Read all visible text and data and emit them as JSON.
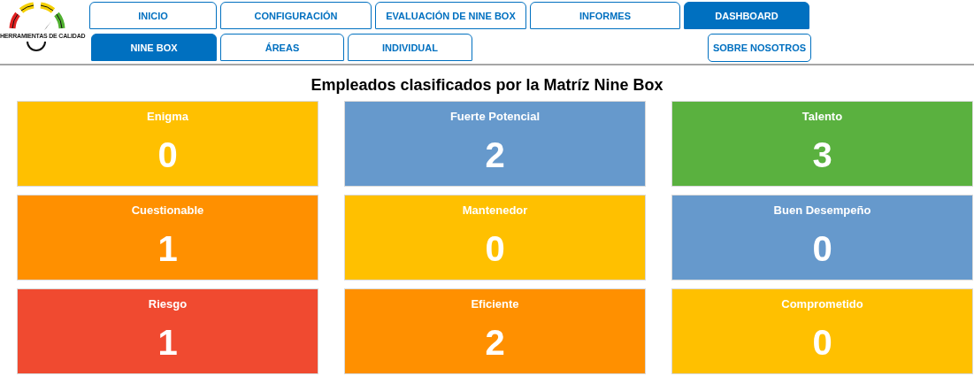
{
  "logo": {
    "caption": "HERRAMIENTAS DE CALIDAD"
  },
  "primary_tabs": [
    {
      "label": "INICIO",
      "selected": false
    },
    {
      "label": "CONFIGURACIÓN",
      "selected": false
    },
    {
      "label": "EVALUACIÓN DE NINE BOX",
      "selected": false
    },
    {
      "label": "INFORMES",
      "selected": false
    },
    {
      "label": "DASHBOARD",
      "selected": true
    }
  ],
  "secondary_tabs": [
    {
      "label": "NINE BOX",
      "selected": true
    },
    {
      "label": "ÁREAS",
      "selected": false
    },
    {
      "label": "INDIVIDUAL",
      "selected": false
    }
  ],
  "about_button": {
    "label": "SOBRE NOSOTROS"
  },
  "title": "Empleados clasificados por la Matríz Nine Box",
  "boxes": [
    {
      "label": "Enigma",
      "count": "0",
      "color": "#ffc000"
    },
    {
      "label": "Fuerte Potencial",
      "count": "2",
      "color": "#6699cc"
    },
    {
      "label": "Talento",
      "count": "3",
      "color": "#5ab13f"
    },
    {
      "label": "Cuestionable",
      "count": "1",
      "color": "#ff9000"
    },
    {
      "label": "Mantenedor",
      "count": "0",
      "color": "#ffc000"
    },
    {
      "label": "Buen Desempeño",
      "count": "0",
      "color": "#6699cc"
    },
    {
      "label": "Riesgo",
      "count": "1",
      "color": "#f04a30"
    },
    {
      "label": "Eficiente",
      "count": "2",
      "color": "#ff9000"
    },
    {
      "label": "Comprometido",
      "count": "0",
      "color": "#ffc000"
    }
  ]
}
